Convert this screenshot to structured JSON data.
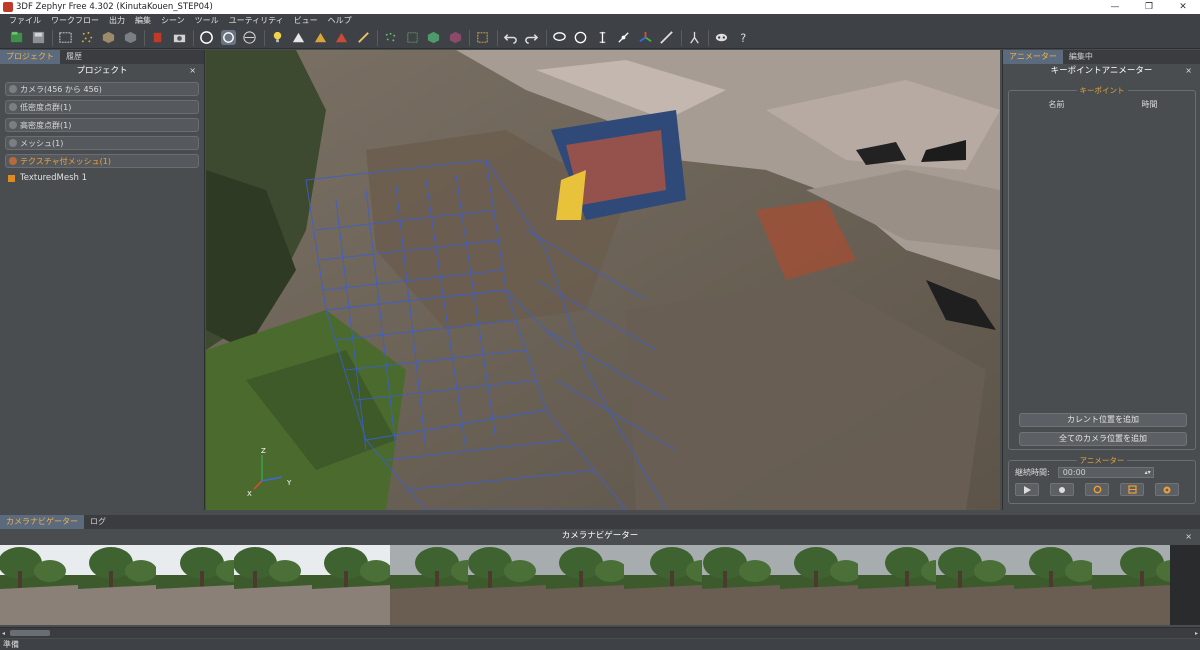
{
  "window": {
    "title": "3DF Zephyr Free 4.302 (KinutaKouen_STEP04)"
  },
  "menu": [
    "ファイル",
    "ワークフロー",
    "出力",
    "編集",
    "シーン",
    "ツール",
    "ユーティリティ",
    "ビュー",
    "ヘルプ"
  ],
  "left_panel": {
    "tabs": [
      "プロジェクト",
      "履歴"
    ],
    "title": "プロジェクト",
    "groups": [
      "カメラ(456 から 456)",
      "低密度点群(1)",
      "高密度点群(1)",
      "メッシュ(1)",
      "テクスチャ付メッシュ(1)"
    ],
    "tree_item": "TexturedMesh 1"
  },
  "right_panel": {
    "tabs": [
      "アニメーター",
      "編集中"
    ],
    "title": "キーポイントアニメーター",
    "keypoint_legend": "キーポイント",
    "col_name": "名前",
    "col_time": "時間",
    "add_current": "カレント位置を追加",
    "add_all": "全てのカメラ位置を追加",
    "animator_legend": "アニメーター",
    "duration_label": "継続時間:",
    "duration_value": "00:00"
  },
  "viewport": {
    "axis_z": "Z",
    "axis_x": "X",
    "axis_y": "Y"
  },
  "bottom": {
    "tabs": [
      "カメラナビゲーター",
      "ログ"
    ],
    "title": "カメラナビゲーター",
    "thumbnail_count": 15
  },
  "status": "準備",
  "colors": {
    "accent": "#e9a53c",
    "panel": "#4a4d50",
    "toolbar": "#3e4145",
    "wire": "#3a5fd0"
  }
}
